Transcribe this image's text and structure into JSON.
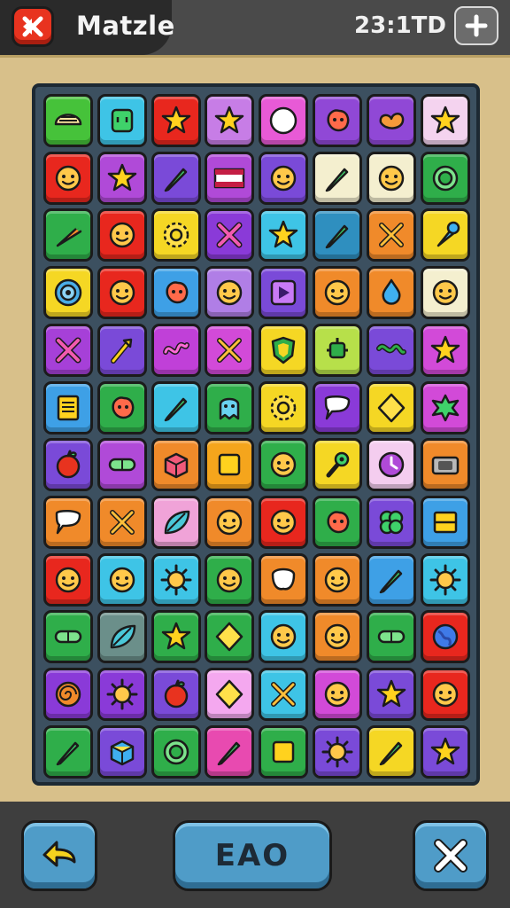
{
  "header": {
    "title": "Matzle",
    "timer": "23:1TD",
    "back_icon": "back-arrow-icon",
    "add_icon": "plus-icon"
  },
  "board": {
    "rows": 12,
    "cols": 8,
    "tiles": [
      [
        {
          "bg": "#46c23a",
          "icon": "shell"
        },
        {
          "bg": "#3ec4e6",
          "icon": "square-face"
        },
        {
          "bg": "#e8271e",
          "icon": "star"
        },
        {
          "bg": "#c77de6",
          "icon": "star"
        },
        {
          "bg": "#e85ad6",
          "icon": "circle"
        },
        {
          "bg": "#9048d6",
          "icon": "blob"
        },
        {
          "bg": "#9048d6",
          "icon": "heart-blob"
        },
        {
          "bg": "#f4d3ef",
          "icon": "star"
        }
      ],
      [
        {
          "bg": "#e8271e",
          "icon": "face"
        },
        {
          "bg": "#b04ad8",
          "icon": "star"
        },
        {
          "bg": "#7a4ad8",
          "icon": "pencil"
        },
        {
          "bg": "#b04ad8",
          "icon": "flag"
        },
        {
          "bg": "#7a4ad8",
          "icon": "face"
        },
        {
          "bg": "#f4efcf",
          "icon": "pencil"
        },
        {
          "bg": "#f4efcf",
          "icon": "face"
        },
        {
          "bg": "#2fae4a",
          "icon": "ring"
        }
      ],
      [
        {
          "bg": "#2fae4a",
          "icon": "carrot"
        },
        {
          "bg": "#e8271e",
          "icon": "face"
        },
        {
          "bg": "#f5d724",
          "icon": "gear"
        },
        {
          "bg": "#8a3ad8",
          "icon": "cross-stick"
        },
        {
          "bg": "#3ec4e6",
          "icon": "star"
        },
        {
          "bg": "#2f8fbf",
          "icon": "pencil"
        },
        {
          "bg": "#f08a2a",
          "icon": "cross"
        },
        {
          "bg": "#f5d724",
          "icon": "cone"
        }
      ],
      [
        {
          "bg": "#f5d724",
          "icon": "target"
        },
        {
          "bg": "#e8271e",
          "icon": "face"
        },
        {
          "bg": "#3ea0e6",
          "icon": "blob"
        },
        {
          "bg": "#b07ee6",
          "icon": "face"
        },
        {
          "bg": "#7a4ad8",
          "icon": "play"
        },
        {
          "bg": "#f08a2a",
          "icon": "face"
        },
        {
          "bg": "#f08a2a",
          "icon": "drop"
        },
        {
          "bg": "#f4efcf",
          "icon": "face"
        }
      ],
      [
        {
          "bg": "#a640d8",
          "icon": "cross-stick"
        },
        {
          "bg": "#7a4ad8",
          "icon": "arrow"
        },
        {
          "bg": "#c040d8",
          "icon": "squiggle"
        },
        {
          "bg": "#d24ad8",
          "icon": "cross"
        },
        {
          "bg": "#f5d724",
          "icon": "shield"
        },
        {
          "bg": "#b7e04a",
          "icon": "robot"
        },
        {
          "bg": "#7a4ad8",
          "icon": "wave"
        },
        {
          "bg": "#d24ad8",
          "icon": "star"
        }
      ],
      [
        {
          "bg": "#3ea0e6",
          "icon": "doc"
        },
        {
          "bg": "#2fae4a",
          "icon": "blob"
        },
        {
          "bg": "#3ec4e6",
          "icon": "pencil"
        },
        {
          "bg": "#2fae4a",
          "icon": "ghost"
        },
        {
          "bg": "#f5d724",
          "icon": "gear"
        },
        {
          "bg": "#8a3ad8",
          "icon": "chat"
        },
        {
          "bg": "#f5d724",
          "icon": "diamond"
        },
        {
          "bg": "#d24ad8",
          "icon": "splat"
        }
      ],
      [
        {
          "bg": "#7a4ad8",
          "icon": "apple"
        },
        {
          "bg": "#b04ad8",
          "icon": "pill"
        },
        {
          "bg": "#f08a2a",
          "icon": "box"
        },
        {
          "bg": "#f5a51c",
          "icon": "square"
        },
        {
          "bg": "#2fae4a",
          "icon": "face"
        },
        {
          "bg": "#f5d724",
          "icon": "flower"
        },
        {
          "bg": "#f4cdef",
          "icon": "clock"
        },
        {
          "bg": "#f08a2a",
          "icon": "camera"
        }
      ],
      [
        {
          "bg": "#f08a2a",
          "icon": "chat"
        },
        {
          "bg": "#f08a2a",
          "icon": "cross"
        },
        {
          "bg": "#f0a3d8",
          "icon": "leaf"
        },
        {
          "bg": "#f08a2a",
          "icon": "face"
        },
        {
          "bg": "#e8271e",
          "icon": "face"
        },
        {
          "bg": "#2fae4a",
          "icon": "blob"
        },
        {
          "bg": "#7a4ad8",
          "icon": "clover"
        },
        {
          "bg": "#3ea0e6",
          "icon": "bars"
        }
      ],
      [
        {
          "bg": "#e8271e",
          "icon": "face"
        },
        {
          "bg": "#3ec4e6",
          "icon": "face"
        },
        {
          "bg": "#3ec4e6",
          "icon": "sun"
        },
        {
          "bg": "#2fae4a",
          "icon": "face"
        },
        {
          "bg": "#f08a2a",
          "icon": "tooth"
        },
        {
          "bg": "#f08a2a",
          "icon": "face"
        },
        {
          "bg": "#3ea0e6",
          "icon": "pencil"
        },
        {
          "bg": "#3ec4e6",
          "icon": "sun"
        }
      ],
      [
        {
          "bg": "#2fae4a",
          "icon": "pill"
        },
        {
          "bg": "#6b8f8a",
          "icon": "leaf"
        },
        {
          "bg": "#2fae4a",
          "icon": "star"
        },
        {
          "bg": "#2fae4a",
          "icon": "diamond"
        },
        {
          "bg": "#3ec4e6",
          "icon": "face"
        },
        {
          "bg": "#f08a2a",
          "icon": "face"
        },
        {
          "bg": "#2fae4a",
          "icon": "pill"
        },
        {
          "bg": "#e8271e",
          "icon": "globe"
        }
      ],
      [
        {
          "bg": "#8a3ad8",
          "icon": "swirl"
        },
        {
          "bg": "#8a3ad8",
          "icon": "sun"
        },
        {
          "bg": "#7a4ad8",
          "icon": "apple"
        },
        {
          "bg": "#f4a8ef",
          "icon": "diamond"
        },
        {
          "bg": "#3ec4e6",
          "icon": "cross"
        },
        {
          "bg": "#d24ad8",
          "icon": "face"
        },
        {
          "bg": "#7a4ad8",
          "icon": "star"
        },
        {
          "bg": "#e8271e",
          "icon": "face"
        }
      ],
      [
        {
          "bg": "#2fae4a",
          "icon": "pencil"
        },
        {
          "bg": "#7a4ad8",
          "icon": "cube"
        },
        {
          "bg": "#2fae4a",
          "icon": "ring"
        },
        {
          "bg": "#e84ab0",
          "icon": "pencil"
        },
        {
          "bg": "#2fae4a",
          "icon": "square"
        },
        {
          "bg": "#7a4ad8",
          "icon": "sun"
        },
        {
          "bg": "#f5d724",
          "icon": "pencil"
        },
        {
          "bg": "#7a4ad8",
          "icon": "star"
        }
      ]
    ]
  },
  "footer": {
    "undo_icon": "undo-arrow-icon",
    "center_label": "EAO",
    "close_icon": "close-icon"
  }
}
